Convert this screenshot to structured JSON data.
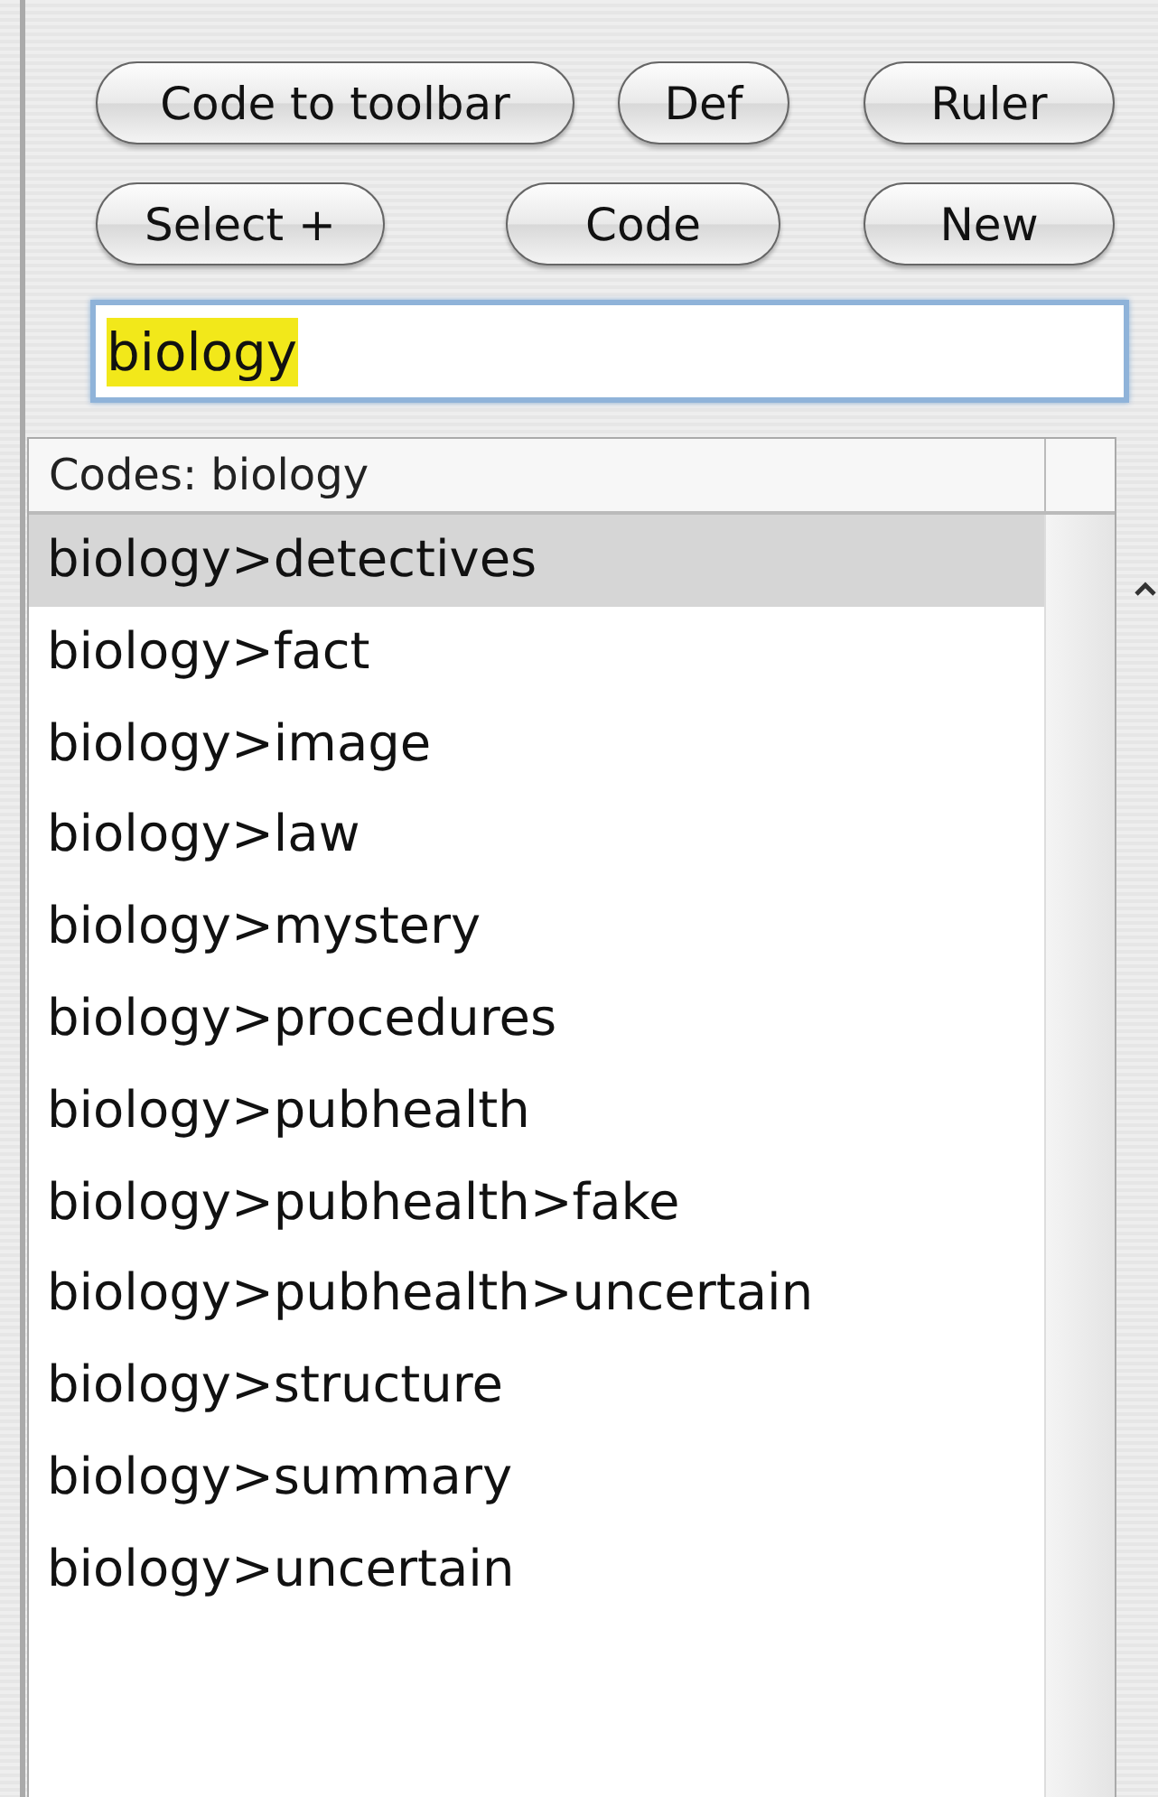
{
  "button_rows": [
    [
      "Code to toolbar",
      "Def",
      "Ruler"
    ],
    [
      "Select +",
      "Code",
      "New"
    ]
  ],
  "search": {
    "value": "biology",
    "text_selected": true
  },
  "table": {
    "columns": [
      "Codes: biology"
    ],
    "rows": [
      {
        "label": "biology>detectives",
        "selected": true
      },
      {
        "label": "biology>fact",
        "selected": false
      },
      {
        "label": "biology>image",
        "selected": false
      },
      {
        "label": "biology>law",
        "selected": false
      },
      {
        "label": "biology>mystery",
        "selected": false
      },
      {
        "label": "biology>procedures",
        "selected": false
      },
      {
        "label": "biology>pubhealth",
        "selected": false
      },
      {
        "label": "biology>pubhealth>fake",
        "selected": false
      },
      {
        "label": "biology>pubhealth>uncertain",
        "selected": false
      },
      {
        "label": "biology>structure",
        "selected": false
      },
      {
        "label": "biology>summary",
        "selected": false
      },
      {
        "label": "biology>uncertain",
        "selected": false
      }
    ]
  }
}
